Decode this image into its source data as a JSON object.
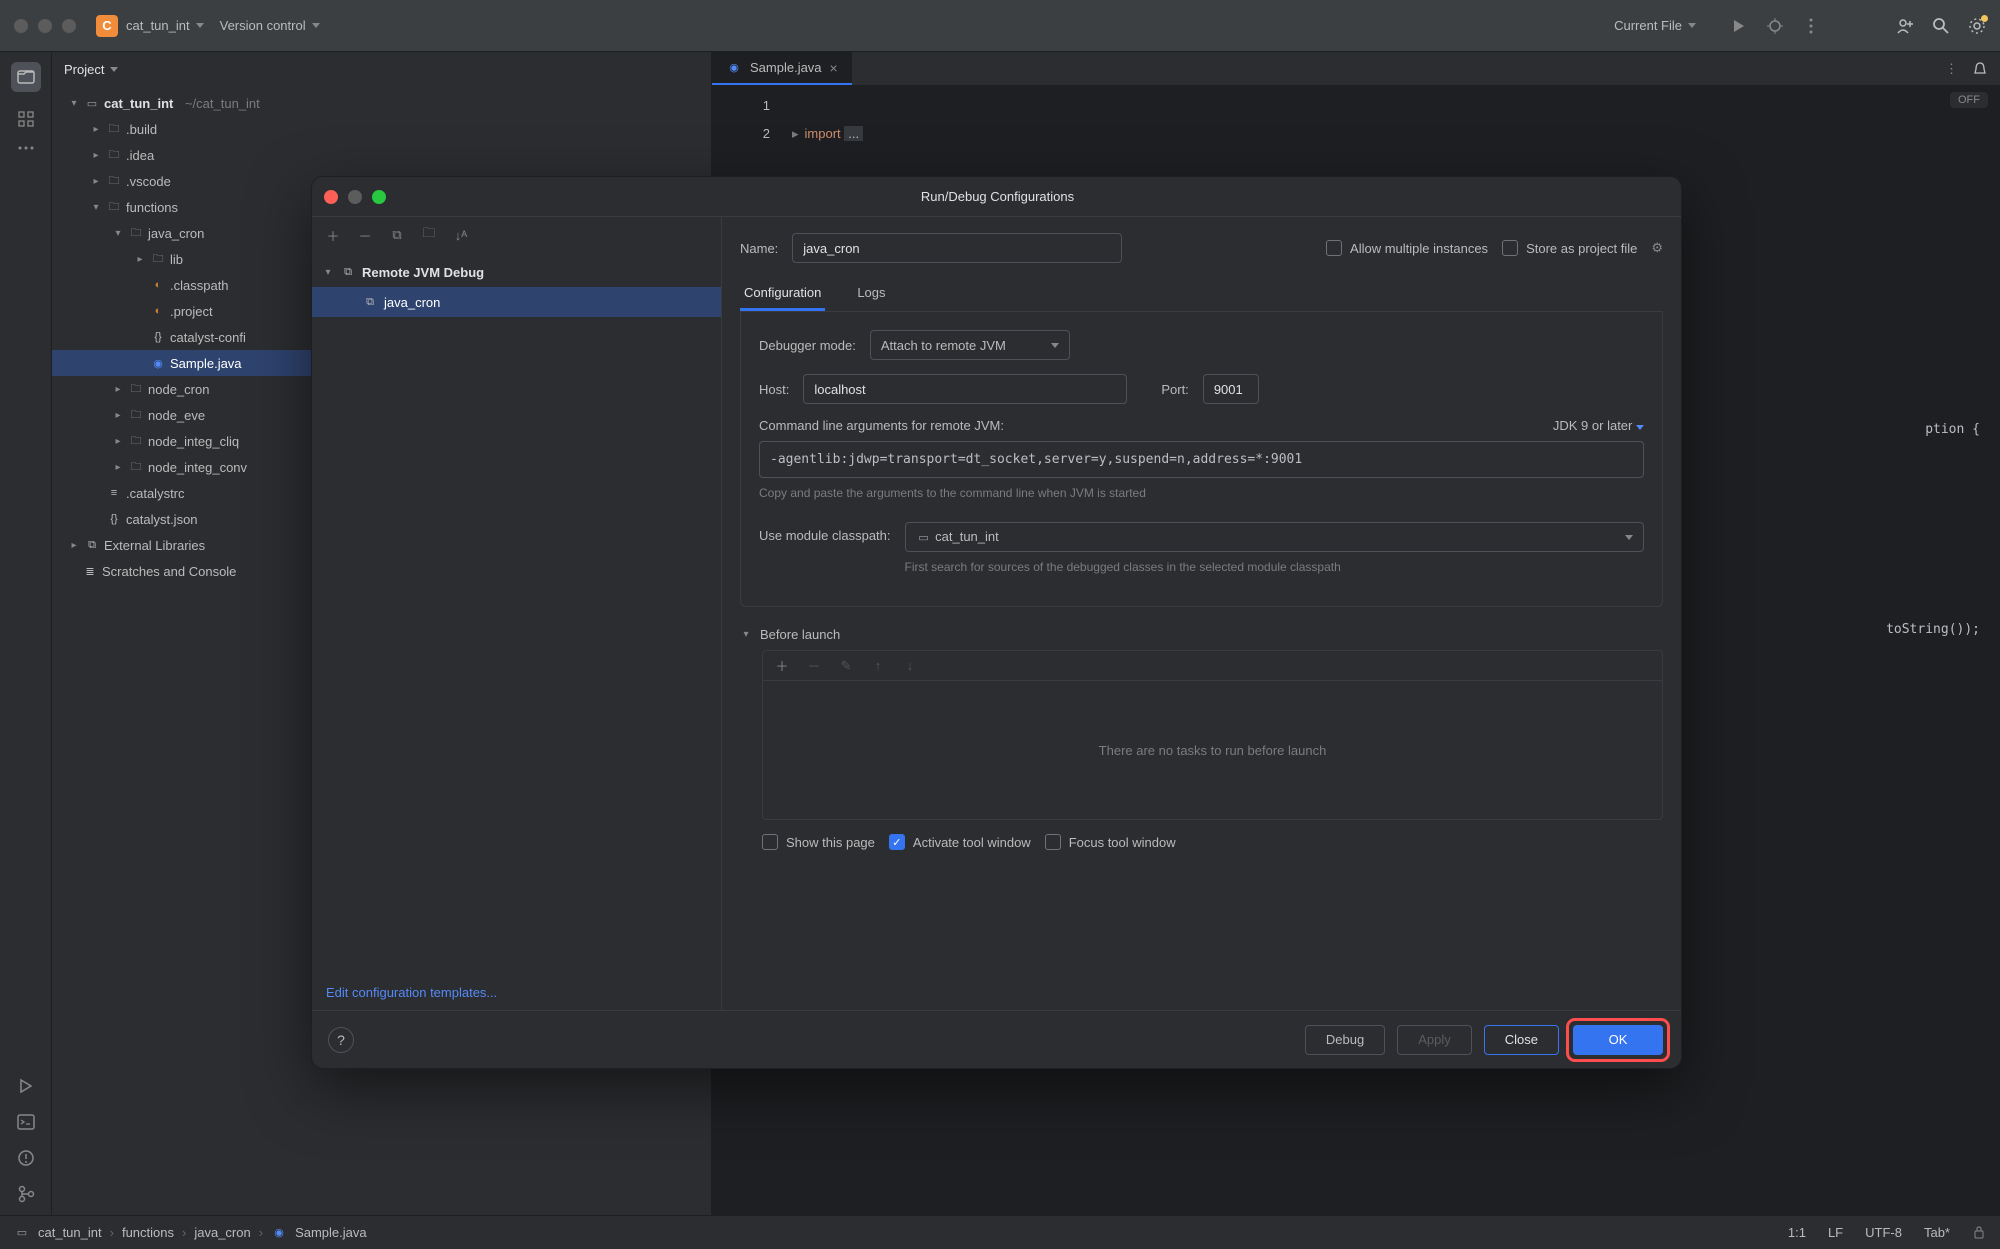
{
  "titlebar": {
    "project": "cat_tun_int",
    "vc": "Version control",
    "current_file": "Current File"
  },
  "sidebar_header": "Project",
  "tree": {
    "root": {
      "name": "cat_tun_int",
      "path": "~/cat_tun_int"
    },
    "build": ".build",
    "idea": ".idea",
    "vscode": ".vscode",
    "functions": "functions",
    "java_cron": "java_cron",
    "lib": "lib",
    "classpath": ".classpath",
    "project": ".project",
    "catalyst_config": "catalyst-confi",
    "sample": "Sample.java",
    "node_cron": "node_cron",
    "node_eve": "node_eve",
    "node_integ_cliq": "node_integ_cliq",
    "node_integ_conv": "node_integ_conv",
    "catalystrc": ".catalystrc",
    "catalyst_json": "catalyst.json",
    "ext_lib": "External Libraries",
    "scratches": "Scratches and Console"
  },
  "editor": {
    "tab": "Sample.java",
    "line1": "1",
    "line2": "2",
    "import": "import",
    "ellipsis": "...",
    "off": "OFF",
    "frag1": "ption {",
    "frag2": "toString());"
  },
  "dialog": {
    "title": "Run/Debug Configurations",
    "toolbar_tree": {
      "group": "Remote JVM Debug",
      "item": "java_cron"
    },
    "edit_templates": "Edit configuration templates...",
    "name_lbl": "Name:",
    "name_val": "java_cron",
    "allow_multi": "Allow multiple instances",
    "store_file": "Store as project file",
    "tab_config": "Configuration",
    "tab_logs": "Logs",
    "debugger_mode_lbl": "Debugger mode:",
    "debugger_mode_val": "Attach to remote JVM",
    "host_lbl": "Host:",
    "host_val": "localhost",
    "port_lbl": "Port:",
    "port_val": "9001",
    "cmd_lbl": "Command line arguments for remote JVM:",
    "jdk": "JDK 9 or later",
    "cmd_val": "-agentlib:jdwp=transport=dt_socket,server=y,suspend=n,address=*:9001",
    "cmd_hint": "Copy and paste the arguments to the command line when JVM is started",
    "classpath_lbl": "Use module classpath:",
    "classpath_val": "cat_tun_int",
    "classpath_hint": "First search for sources of the debugged classes in the selected module classpath",
    "before_launch": "Before launch",
    "before_empty": "There are no tasks to run before launch",
    "show_page": "Show this page",
    "activate_tool": "Activate tool window",
    "focus_tool": "Focus tool window",
    "debug": "Debug",
    "apply": "Apply",
    "close": "Close",
    "ok": "OK"
  },
  "status": {
    "crumbs": [
      "cat_tun_int",
      "functions",
      "java_cron",
      "Sample.java"
    ],
    "pos": "1:1",
    "le": "LF",
    "enc": "UTF-8",
    "indent": "Tab*"
  }
}
